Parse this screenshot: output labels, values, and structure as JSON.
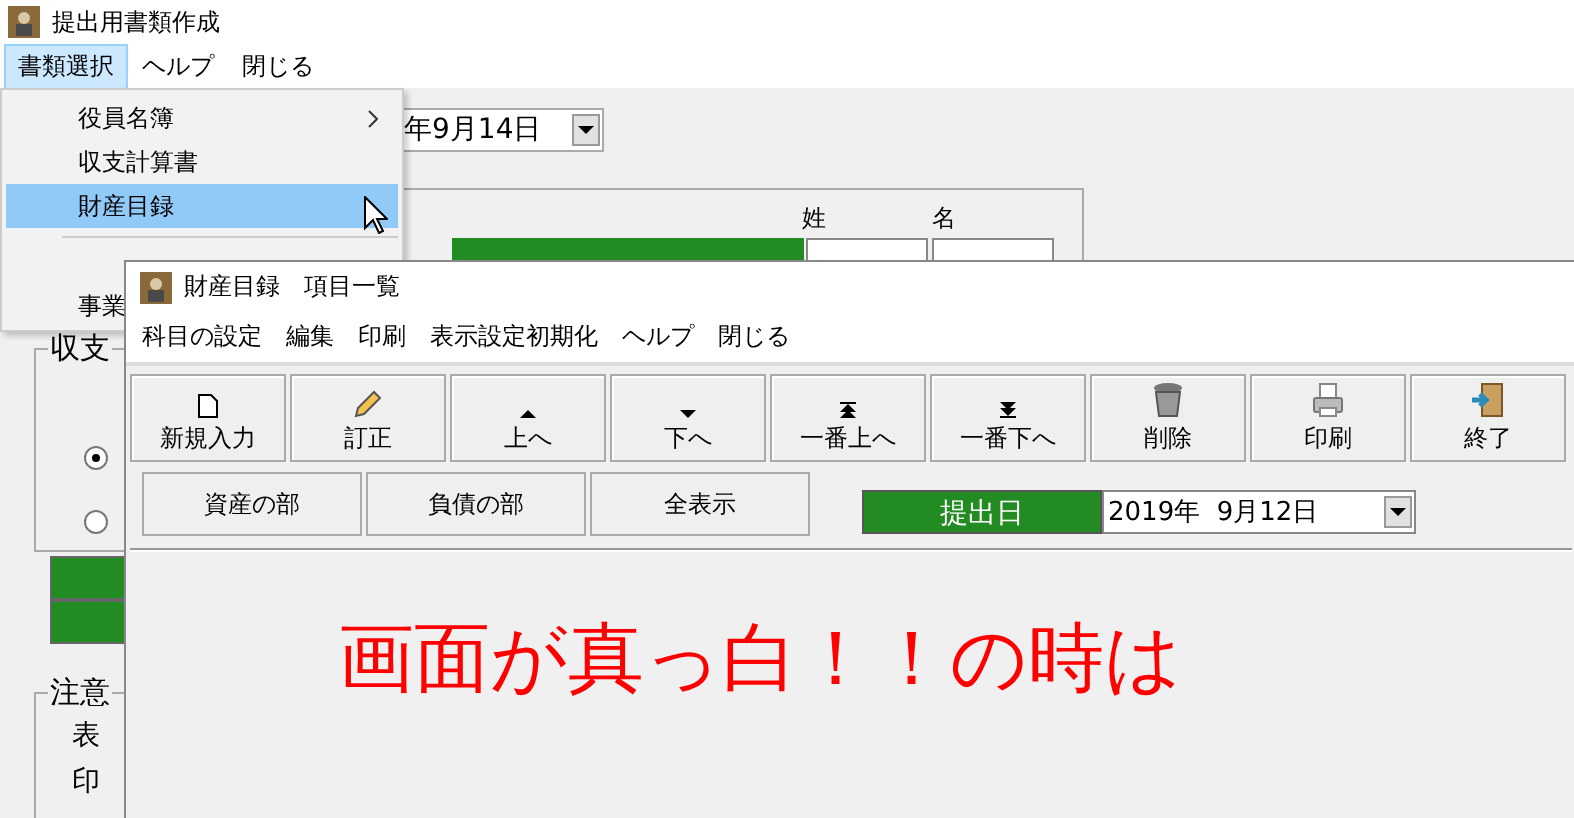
{
  "main_window": {
    "title": "提出用書類作成",
    "menu": [
      {
        "label": "書類選択",
        "selected": true
      },
      {
        "label": "ヘルプ",
        "selected": false
      },
      {
        "label": "閉じる",
        "selected": false
      }
    ],
    "date_field": {
      "value": "年9月14日"
    },
    "name_group": {
      "labels": [
        "姓",
        "名"
      ]
    },
    "balance_group": {
      "title": "収支",
      "radios": [
        {
          "checked": true
        },
        {
          "checked": false
        }
      ]
    },
    "notes_group": {
      "title": "注意",
      "lines": [
        "表",
        "印"
      ]
    }
  },
  "dropdown_menu": {
    "items": [
      {
        "kind": "item",
        "label": "役員名簿",
        "submenu": true,
        "selected": false
      },
      {
        "kind": "item",
        "label": "収支計算書",
        "selected": false
      },
      {
        "kind": "item",
        "label": "財産目録",
        "selected": true
      },
      {
        "kind": "separator"
      },
      {
        "kind": "item",
        "label": "事業",
        "selected": false
      }
    ]
  },
  "sub_window": {
    "title": "財産目録　項目一覧",
    "menu": [
      "科目の設定",
      "編集",
      "印刷",
      "表示設定初期化",
      "ヘルプ",
      "閉じる"
    ],
    "toolbar": [
      {
        "kind": "new",
        "label": "新規入力"
      },
      {
        "kind": "edit",
        "label": "訂正"
      },
      {
        "kind": "up",
        "label": "上へ"
      },
      {
        "kind": "down",
        "label": "下へ"
      },
      {
        "kind": "top",
        "label": "一番上へ"
      },
      {
        "kind": "bottom",
        "label": "一番下へ"
      },
      {
        "kind": "delete",
        "label": "削除"
      },
      {
        "kind": "print",
        "label": "印刷"
      },
      {
        "kind": "exit",
        "label": "終了"
      }
    ],
    "filters": [
      "資産の部",
      "負債の部",
      "全表示"
    ],
    "submit_date": {
      "label": "提出日",
      "value": "2019年  9月12日"
    },
    "notice": "画面が真っ白！！の時は"
  }
}
